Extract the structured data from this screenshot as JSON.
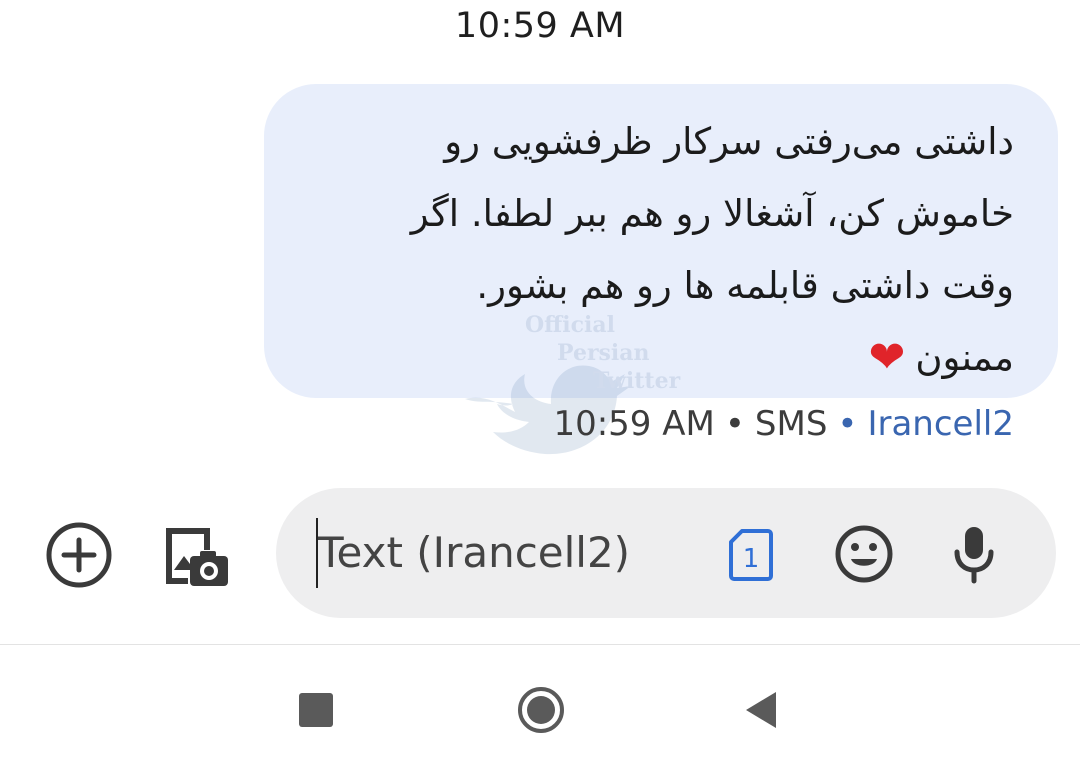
{
  "conversation": {
    "top_timestamp": "10:59 AM",
    "message": {
      "line1": "داشتی می‌رفتی سرکار ظرفشویی رو",
      "line2": "خاموش کن، آشغالا رو هم ببر لطفا. اگر",
      "line3": "وقت داشتی قابلمه ها رو هم بشور.",
      "line4": "ممنون",
      "emoji": "❤",
      "time": "10:59 AM",
      "separator": "•",
      "type": "SMS",
      "carrier": "Irancell2"
    },
    "watermark": {
      "word1": "Official",
      "word2": "Persian",
      "word3": "Twitter"
    }
  },
  "composer": {
    "placeholder": "Text (Irancell2)",
    "sim_slot": "1",
    "icons": {
      "add": "plus-circle-icon",
      "gallery": "gallery-camera-icon",
      "sim": "sim-card-icon",
      "emoji": "emoji-smile-icon",
      "mic": "microphone-icon"
    }
  },
  "navigation": {
    "icons": [
      "recents-square-icon",
      "home-circle-icon",
      "back-triangle-icon"
    ]
  },
  "colors": {
    "bubble": "#e8eefb",
    "carrier_link": "#3a66b0",
    "input_bg": "#eeeeef",
    "heart": "#e0242a",
    "sim_accent": "#2f6fd6"
  }
}
